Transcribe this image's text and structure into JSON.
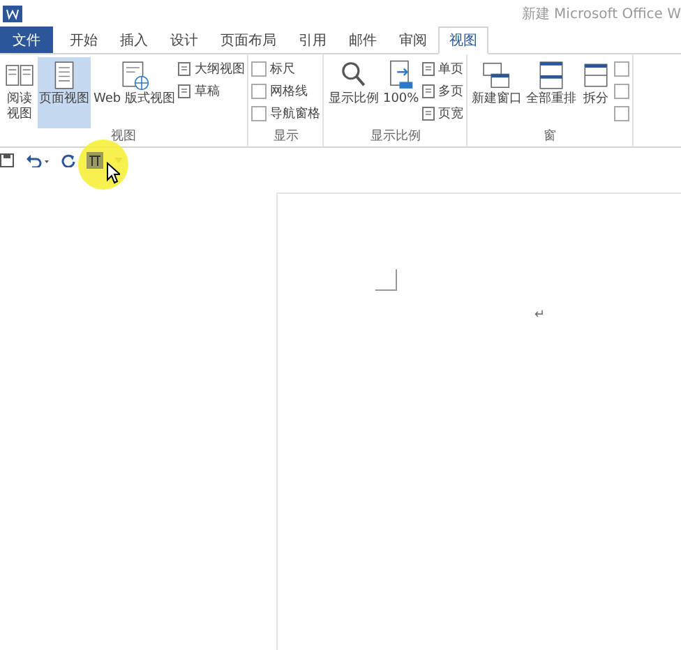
{
  "window": {
    "title": "新建 Microsoft Office W"
  },
  "tabs": [
    {
      "label": "文件",
      "kind": "file",
      "selected": false
    },
    {
      "label": "开始",
      "kind": "tab",
      "selected": false
    },
    {
      "label": "插入",
      "kind": "tab",
      "selected": false
    },
    {
      "label": "设计",
      "kind": "tab",
      "selected": false
    },
    {
      "label": "页面布局",
      "kind": "tab",
      "selected": false
    },
    {
      "label": "引用",
      "kind": "tab",
      "selected": false
    },
    {
      "label": "邮件",
      "kind": "tab",
      "selected": false
    },
    {
      "label": "审阅",
      "kind": "tab",
      "selected": false
    },
    {
      "label": "视图",
      "kind": "tab",
      "selected": true
    }
  ],
  "ribbon": {
    "groups": [
      {
        "label": "视图",
        "columns": [
          {
            "kind": "narrow",
            "items": [
              {
                "label": "阅读视图",
                "selected": false
              }
            ]
          },
          {
            "kind": "large",
            "items": [
              {
                "label": "页面视图",
                "selected": true
              }
            ]
          },
          {
            "kind": "large",
            "items": [
              {
                "label": "Web 版式视图",
                "selected": false
              }
            ]
          },
          {
            "kind": "small",
            "items": [
              {
                "label": "大纲视图"
              },
              {
                "label": "草稿"
              }
            ]
          }
        ]
      },
      {
        "label": "显示",
        "columns": [
          {
            "kind": "check",
            "items": [
              {
                "label": "标尺",
                "checked": false
              },
              {
                "label": "网格线",
                "checked": false
              },
              {
                "label": "导航窗格",
                "checked": false
              }
            ]
          }
        ]
      },
      {
        "label": "显示比例",
        "columns": [
          {
            "kind": "large",
            "items": [
              {
                "label": "显示比例",
                "selected": false
              }
            ]
          },
          {
            "kind": "large",
            "items": [
              {
                "label": "100%",
                "selected": false
              }
            ]
          },
          {
            "kind": "small",
            "items": [
              {
                "label": "单页"
              },
              {
                "label": "多页"
              },
              {
                "label": "页宽"
              }
            ]
          }
        ]
      },
      {
        "label": "窗",
        "columns": [
          {
            "kind": "large",
            "items": [
              {
                "label": "新建窗口",
                "selected": false
              }
            ]
          },
          {
            "kind": "large",
            "items": [
              {
                "label": "全部重排",
                "selected": false
              }
            ]
          },
          {
            "kind": "large",
            "items": [
              {
                "label": "拆分",
                "selected": false
              }
            ]
          },
          {
            "kind": "check",
            "items": [
              {
                "checked": false
              },
              {
                "checked": false
              },
              {
                "checked": false
              }
            ]
          }
        ]
      }
    ]
  },
  "document": {
    "paragraph_mark": "↵"
  }
}
